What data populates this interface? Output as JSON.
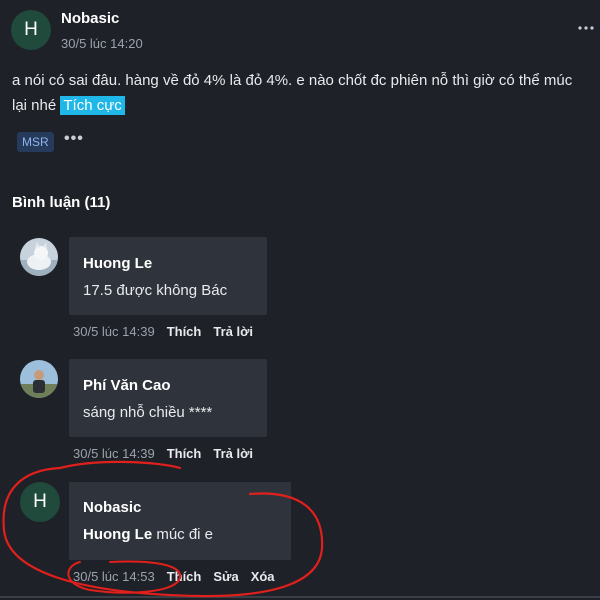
{
  "post": {
    "avatar_letter": "H",
    "author": "Nobasic",
    "timestamp": "30/5 lúc 14:20",
    "menu_icon": "more-dots-icon",
    "text_line1": "a nói có sai đâu. hàng về đỏ 4% là đỏ 4%. e nào chốt đc phiên nỗ thì giờ có thể múc",
    "text_line2_prefix": "lại nhé",
    "sentiment_label": "Tích cực",
    "tag": "MSR",
    "tag_more": "•••"
  },
  "comments_section": {
    "title": "Bình luận (11)"
  },
  "comments": [
    {
      "author": "Huong Le",
      "text": "17.5 được không Bác",
      "time": "30/5 lúc 14:39",
      "actions": [
        "Thích",
        "Trả lời"
      ]
    },
    {
      "author": "Phí Văn Cao",
      "text": "sáng nhỗ chiều ****",
      "time": "30/5 lúc 14:39",
      "actions": [
        "Thích",
        "Trả lời"
      ]
    },
    {
      "avatar_letter": "H",
      "author": "Nobasic",
      "mention": "Huong Le",
      "text": "múc đi e",
      "time": "30/5 lúc 14:53",
      "actions": [
        "Thích",
        "Sửa",
        "Xóa"
      ]
    }
  ],
  "colors": {
    "background": "#1e2127",
    "bubble": "#2f343c",
    "highlight": "#1fb6e8",
    "annotation_red": "#e0201c",
    "avatar_green": "#1f4a3c"
  }
}
